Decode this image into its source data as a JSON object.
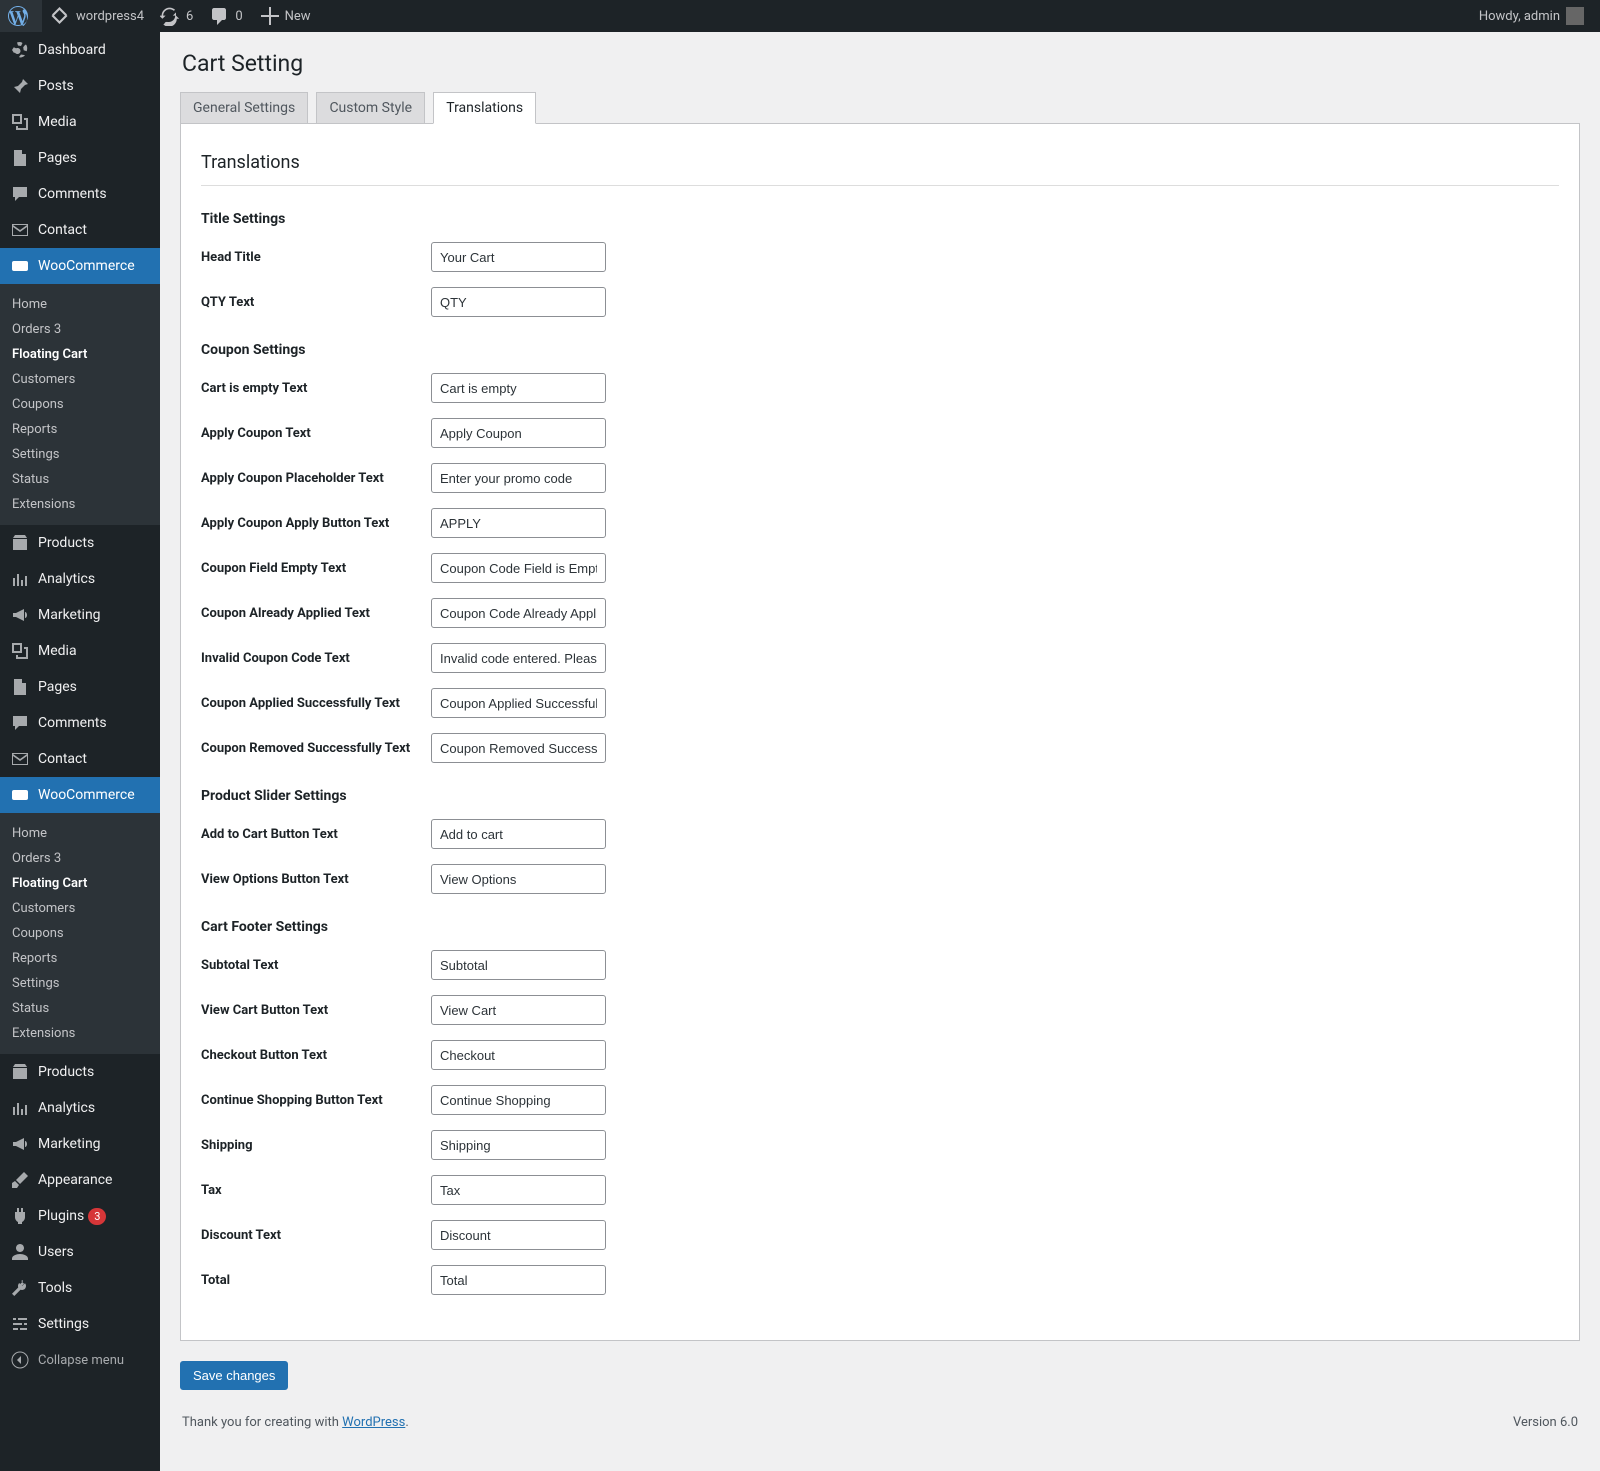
{
  "adminbar": {
    "site_name": "wordpress4",
    "updates_count": "6",
    "comments_count": "0",
    "new_label": "New",
    "howdy_text": "Howdy, admin"
  },
  "sidebar": {
    "dashboard": "Dashboard",
    "posts": "Posts",
    "media": "Media",
    "pages": "Pages",
    "comments": "Comments",
    "contact": "Contact",
    "woocommerce": "WooCommerce",
    "products": "Products",
    "analytics": "Analytics",
    "marketing": "Marketing",
    "appearance": "Appearance",
    "plugins": "Plugins",
    "plugins_badge": "3",
    "users": "Users",
    "tools": "Tools",
    "settings": "Settings",
    "collapse": "Collapse menu",
    "sub": {
      "home": "Home",
      "orders": "Orders",
      "orders_badge": "3",
      "floating_cart": "Floating Cart",
      "customers": "Customers",
      "coupons": "Coupons",
      "reports": "Reports",
      "settings": "Settings",
      "status": "Status",
      "extensions": "Extensions"
    }
  },
  "page": {
    "title": "Cart Setting",
    "tabs": {
      "general": "General Settings",
      "custom": "Custom Style",
      "translations": "Translations"
    },
    "section_title": "Translations",
    "sections": {
      "title_settings": "Title Settings",
      "coupon_settings": "Coupon Settings",
      "product_slider": "Product Slider Settings",
      "cart_footer": "Cart Footer Settings"
    },
    "fields": {
      "head_title": {
        "label": "Head Title",
        "value": "Your Cart"
      },
      "qty_text": {
        "label": "QTY Text",
        "value": "QTY"
      },
      "cart_empty": {
        "label": "Cart is empty Text",
        "value": "Cart is empty"
      },
      "apply_coupon": {
        "label": "Apply Coupon Text",
        "value": "Apply Coupon"
      },
      "apply_coupon_placeholder": {
        "label": "Apply Coupon Placeholder Text",
        "value": "Enter your promo code"
      },
      "apply_coupon_btn": {
        "label": "Apply Coupon Apply Button Text",
        "value": "APPLY"
      },
      "coupon_field_empty": {
        "label": "Coupon Field Empty Text",
        "value": "Coupon Code Field is Empty"
      },
      "coupon_already": {
        "label": "Coupon Already Applied Text",
        "value": "Coupon Code Already Applied"
      },
      "invalid_coupon": {
        "label": "Invalid Coupon Code Text",
        "value": "Invalid code entered. Please try again"
      },
      "coupon_applied_ok": {
        "label": "Coupon Applied Successfully Text",
        "value": "Coupon Applied Successfully"
      },
      "coupon_removed_ok": {
        "label": "Coupon Removed Successfully Text",
        "value": "Coupon Removed Successfully"
      },
      "add_to_cart": {
        "label": "Add to Cart Button Text",
        "value": "Add to cart"
      },
      "view_options": {
        "label": "View Options Button Text",
        "value": "View Options"
      },
      "subtotal": {
        "label": "Subtotal Text",
        "value": "Subtotal"
      },
      "view_cart": {
        "label": "View Cart Button Text",
        "value": "View Cart"
      },
      "checkout": {
        "label": "Checkout Button Text",
        "value": "Checkout"
      },
      "continue_shopping": {
        "label": "Continue Shopping Button Text",
        "value": "Continue Shopping"
      },
      "shipping": {
        "label": "Shipping",
        "value": "Shipping"
      },
      "tax": {
        "label": "Tax",
        "value": "Tax"
      },
      "discount": {
        "label": "Discount Text",
        "value": "Discount"
      },
      "total": {
        "label": "Total",
        "value": "Total"
      }
    },
    "save_btn": "Save changes"
  },
  "footer": {
    "thanks_pre": "Thank you for creating with ",
    "thanks_link": "WordPress",
    "thanks_post": ".",
    "version": "Version 6.0"
  }
}
